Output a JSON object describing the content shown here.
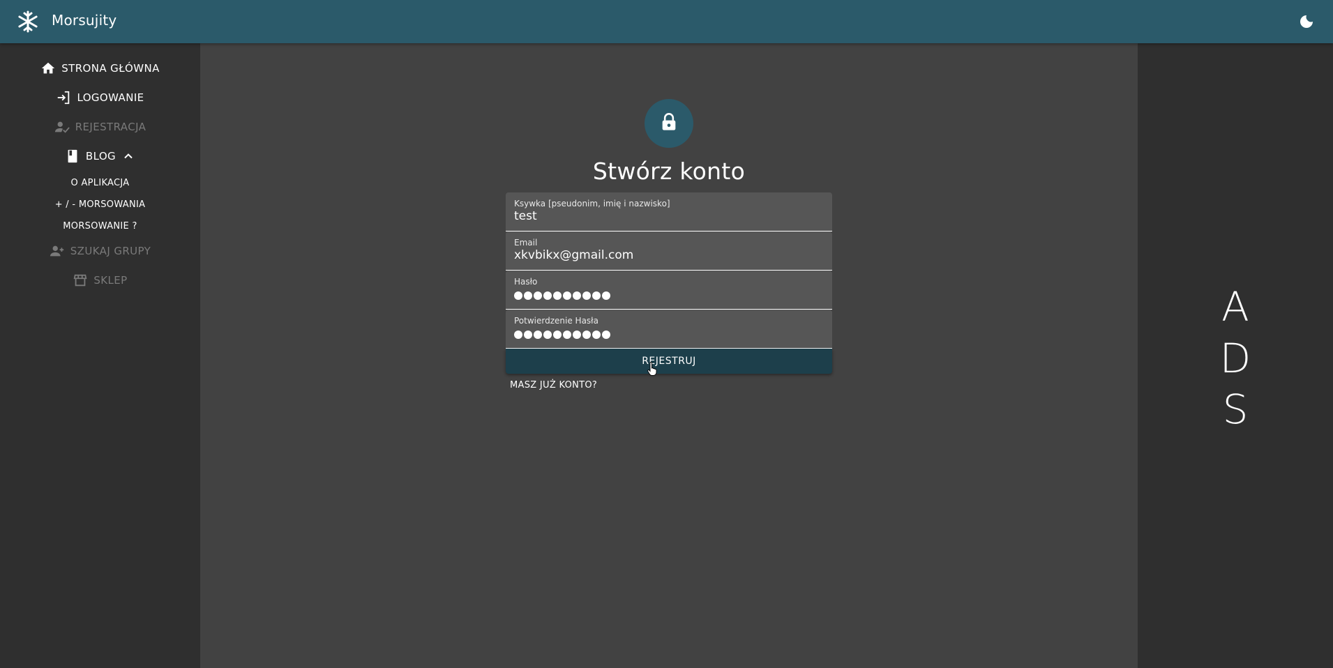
{
  "header": {
    "app_title": "Morsujity",
    "logo_icon": "snowflake-icon",
    "theme_toggle_icon": "moon-icon",
    "bar_color": "#2b5a6a"
  },
  "sidebar": {
    "items": [
      {
        "label": "STRONA GŁÓWNA",
        "icon": "home-icon",
        "disabled": false
      },
      {
        "label": "LOGOWANIE",
        "icon": "login-icon",
        "disabled": false
      },
      {
        "label": "REJESTRACJA",
        "icon": "person-check-icon",
        "disabled": true
      },
      {
        "label": "BLOG",
        "icon": "book-icon",
        "disabled": false,
        "expanded": true
      },
      {
        "label": "SZUKAJ GRUPY",
        "icon": "group-add-icon",
        "disabled": true
      },
      {
        "label": "SKLEP",
        "icon": "store-icon",
        "disabled": true
      }
    ],
    "blog_subitems": [
      {
        "label": "O APLIKACJA"
      },
      {
        "label": "+ / - MORSOWANIA"
      },
      {
        "label": "MORSOWANIE ?"
      }
    ]
  },
  "form": {
    "title": "Stwórz konto",
    "icon": "lock-icon",
    "fields": [
      {
        "label": "Ksywka [pseudonim, imię i nazwisko]",
        "value": "test"
      },
      {
        "label": "Email",
        "value": "xkvbikx@gmail.com"
      },
      {
        "label": "Hasło",
        "masked_length": 10
      },
      {
        "label": "Potwierdzenie Hasła",
        "masked_length": 10
      }
    ],
    "submit_label": "REJESTRUJ",
    "login_link": "MASZ JUŻ KONTO?",
    "button_color": "#1d3f4b"
  },
  "ads": {
    "letters": [
      "A",
      "D",
      "S"
    ]
  }
}
